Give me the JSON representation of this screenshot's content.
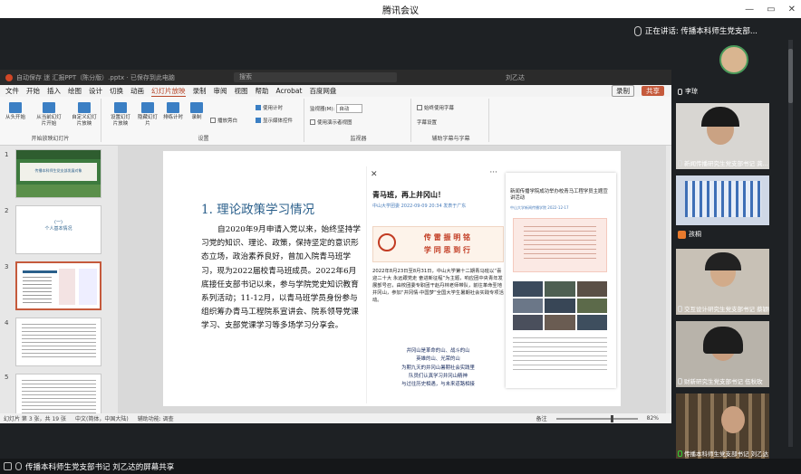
{
  "app_title": "腾讯会议",
  "window_controls": [
    "—",
    "▭",
    "✕"
  ],
  "speaking": {
    "label": "正在讲话: 传播本科师生党支部..."
  },
  "ppt": {
    "title": "自动保存  迷 汇报PPT（陈分版）.pptx · 已保存到此电脑",
    "search_placeholder": "搜索",
    "user": "刘乙达",
    "menu": [
      "文件",
      "开始",
      "插入",
      "绘图",
      "设计",
      "切换",
      "动画",
      "幻灯片放映",
      "录制",
      "审阅",
      "视图",
      "帮助",
      "Acrobat",
      "百度网盘"
    ],
    "menu_active": "幻灯片放映",
    "record_button": "录制",
    "share_button": "共享",
    "ribbon": {
      "groups": [
        {
          "label": "开始放映幻灯片",
          "buttons": [
            "从头开始",
            "从当前幻灯片开始",
            "自定义幻灯片放映"
          ]
        },
        {
          "label": "设置",
          "buttons": [
            "设置幻灯片放映",
            "隐藏幻灯片",
            "排练计时",
            "录制"
          ]
        },
        {
          "label": "监视器",
          "buttons": []
        },
        {
          "label": "辅助字幕与字幕",
          "buttons": []
        }
      ],
      "checks": {
        "play_narration": "播放旁白",
        "use_timings": "使用计时",
        "show_media_controls": "显示媒体控件",
        "monitor_label": "监视器(M):",
        "monitor_value": "自动",
        "presenter_view": "使用演示者视图",
        "always_subtitles": "始终使用字幕",
        "subtitle_settings": "字幕设置"
      }
    },
    "thumb_numbers": [
      "1",
      "2",
      "3",
      "4",
      "5"
    ],
    "thumb1_title": "传播本科师生党支部发展对象",
    "thumb2_title": "(一)\n个人基本情况",
    "slide": {
      "heading": "1. 理论政策学习情况",
      "body": "自2020年9月申请入党以来，始终坚持学习党的知识、理论、政策，保持坚定的意识形态立场，政治素养良好，曾加入院青马班学习，现为2022届校青马班成员。2022年6月底接任支部书记以来，参与学院党史知识教育系列活动；11-12月，以青马班学员身份参与组织筹办青马工程院系宣讲会、院系领导党课学习、支部党课学习等多场学习分享会。",
      "article1": {
        "title": "青马班，再上井冈山！",
        "meta": "中山大学团委  2022-09-09 20:34  发表于广东",
        "banner": "传  雷  振  明  铭\n学  同  思  到  行",
        "para": "2022年8月23日至8月31日，中山大学第十二期青马班以“喜迎二十大 永远跟党走 奋进新征程”为主题，响应团中央青年发展部号召，由校团委专职团干赵丹林老师带队，前往革命圣地井冈山，参加“井冈情·中国梦”全国大学生暑期社会实践专项活动。",
        "poem": "井冈山是革命的山、战斗的山\n英雄的山、光荣的山\n为期九天的井冈山暑期社会实践里\n队员们认真学习井冈山精神\n与过往历史相遇，与未来道路相接"
      },
      "article2": {
        "title": "新闻传播学院成功举办校青马工程学员主题宣讲活动",
        "meta": "中山大学新闻传播学院  2022-12-17"
      }
    },
    "status": {
      "slide_info": "幻灯片 第 3 张，共 19 张",
      "language": "中文(简体，中国大陆)",
      "accessibility": "辅助功能: 调查",
      "notes": "备注",
      "zoom": "82%"
    }
  },
  "participants": [
    {
      "name": "李琼"
    },
    {
      "name": "新闻传播研究生党支部书记 龚..."
    },
    {
      "name": "孩桐"
    },
    {
      "name": "交互设计研究生党支部书记 蔡颖晴"
    },
    {
      "name": "财新研究生党支部书记 伍秋玫"
    },
    {
      "name": "传播本科师生党支部书记 刘乙达"
    }
  ],
  "bottom_bar": {
    "label": "传播本科师生党支部书记 刘乙达的屏幕共享"
  }
}
